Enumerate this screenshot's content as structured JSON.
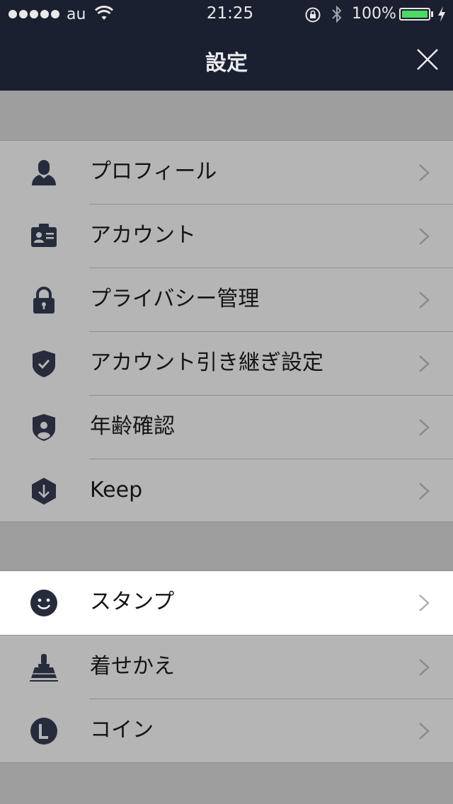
{
  "status_bar": {
    "carrier": "au",
    "time": "21:25",
    "battery_percent": "100%"
  },
  "header": {
    "title": "設定"
  },
  "colors": {
    "nav_bar": "#1b2030",
    "icon": "#262c3c",
    "row_background": "#b5b5b5",
    "highlight_row": "#ffffff",
    "battery_fill": "#4cd964"
  },
  "groups": [
    {
      "items": [
        {
          "label": "プロフィール",
          "icon": "person-icon"
        },
        {
          "label": "アカウント",
          "icon": "id-card-icon"
        },
        {
          "label": "プライバシー管理",
          "icon": "padlock-icon"
        },
        {
          "label": "アカウント引き継ぎ設定",
          "icon": "shield-check-icon"
        },
        {
          "label": "年齢確認",
          "icon": "shield-person-icon"
        },
        {
          "label": "Keep",
          "icon": "keep-download-icon"
        }
      ]
    },
    {
      "items": [
        {
          "label": "スタンプ",
          "icon": "smiley-icon"
        },
        {
          "label": "着せかえ",
          "icon": "brush-icon"
        },
        {
          "label": "コイン",
          "icon": "coin-icon"
        }
      ]
    }
  ]
}
